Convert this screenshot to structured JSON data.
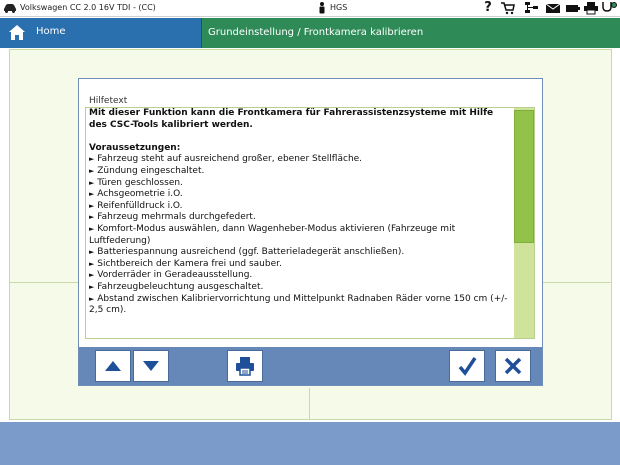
{
  "statusbar": {
    "vehicle": "Volkswagen CC 2.0 16V TDI - (CC)",
    "user": "HGS",
    "icons": [
      "car-icon",
      "user-icon",
      "help-icon",
      "cart-icon",
      "network-icon",
      "mail-icon",
      "battery-icon",
      "printer-icon",
      "tools-icon",
      "stethoscope-icon"
    ],
    "help_glyph": "?"
  },
  "navbar": {
    "home_label": "Home",
    "breadcrumb": "Grundeinstellung / Frontkamera kalibrieren"
  },
  "dialog": {
    "title": "Hilfetext",
    "intro": "Mit dieser Funktion kann die Frontkamera für Fahrerassistenzsysteme mit Hilfe des CSC-Tools kalibriert werden.",
    "section_heading": "Voraussetzungen:",
    "bullet_glyph": "►",
    "items": [
      "Fahrzeug steht auf ausreichend großer, ebener Stellfläche.",
      "Zündung eingeschaltet.",
      "Türen geschlossen.",
      "Achsgeometrie i.O.",
      "Reifenfülldruck i.O.",
      "Fahrzeug mehrmals durchgefedert.",
      "Komfort-Modus auswählen, dann Wagenheber-Modus aktivieren (Fahrzeuge mit Luftfederung)",
      "Batteriespannung ausreichend (ggf. Batterieladegerät anschließen).",
      "Sichtbereich der Kamera frei und sauber.",
      "Vorderräder in Geradeausstellung.",
      "Fahrzeugbeleuchtung ausgeschaltet.",
      "Abstand zwischen Kalibriervorrichtung und Mittelpunkt Radnaben Räder vorne 150 cm (+/- 2,5 cm)."
    ],
    "scroll_position": 0.0
  },
  "toolbar": {
    "buttons": [
      "scroll-up-button",
      "scroll-down-button",
      "print-button",
      "confirm-button",
      "cancel-button"
    ]
  },
  "colors": {
    "nav_green": "#2e8b57",
    "home_blue": "#2a6fae",
    "toolbar_blue": "#6688b8",
    "footer_blue": "#7b9bcb",
    "accent_button": "#1f4f99",
    "scroll_green": "#93c24a"
  }
}
